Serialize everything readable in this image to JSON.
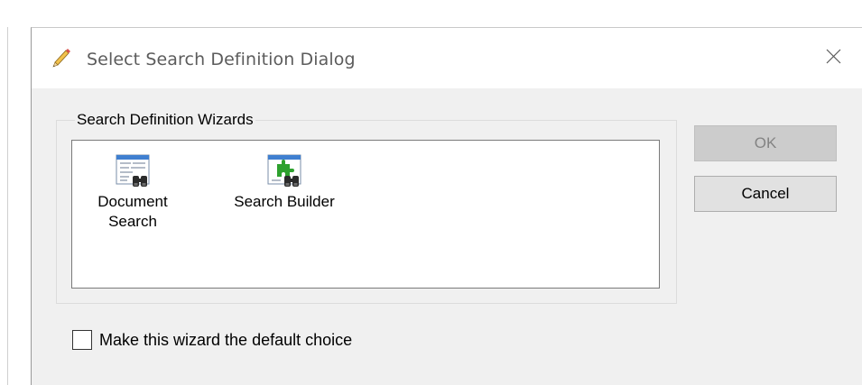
{
  "dialog": {
    "title": "Select Search Definition Dialog",
    "title_icon": "pencil-icon",
    "close_icon": "close-icon"
  },
  "wizards": {
    "group_label": "Search Definition Wizards",
    "items": [
      {
        "line1": "Document",
        "line2": "Search",
        "icon": "document-search-icon"
      },
      {
        "line1": "Search Builder",
        "line2": "",
        "icon": "search-builder-icon"
      }
    ]
  },
  "buttons": {
    "ok_label": "OK",
    "ok_enabled": false,
    "cancel_label": "Cancel"
  },
  "default_choice": {
    "label": "Make this wizard the default choice",
    "checked": false
  },
  "colors": {
    "dialog_background": "#f0f0f0",
    "titlebar_background": "#ffffff",
    "disabled_text": "#838383",
    "icon_accent_green": "#2ea12e"
  }
}
